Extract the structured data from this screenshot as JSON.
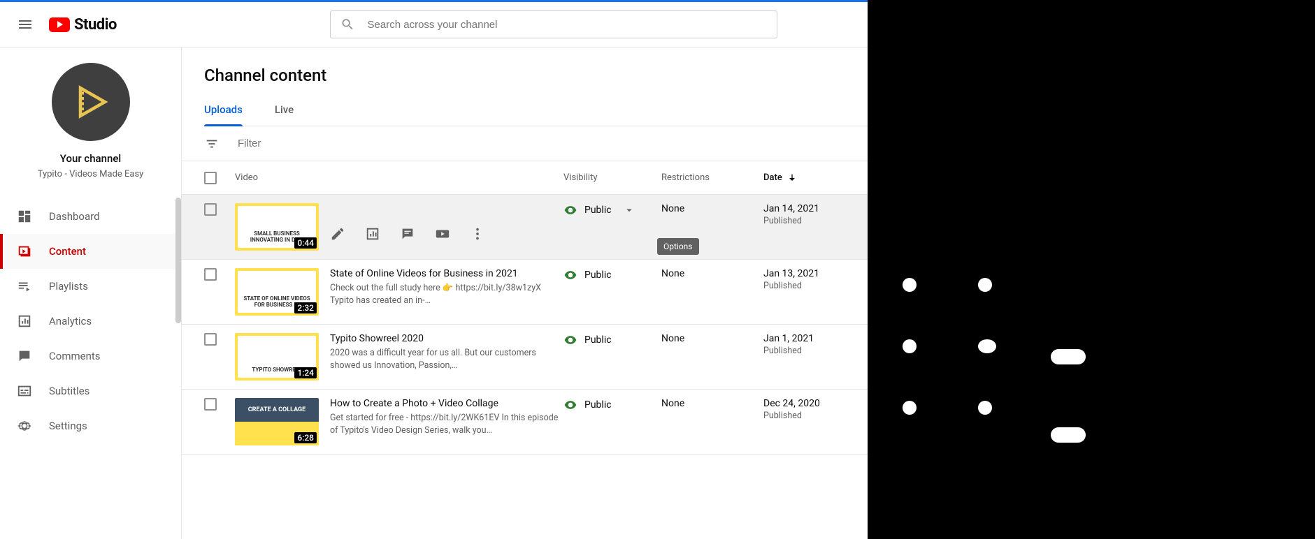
{
  "header": {
    "logo_text": "Studio",
    "search_placeholder": "Search across your channel"
  },
  "sidebar": {
    "channel_title": "Your channel",
    "channel_subtitle": "Typito - Videos Made Easy",
    "items": [
      {
        "label": "Dashboard",
        "icon": "dashboard"
      },
      {
        "label": "Content",
        "icon": "content",
        "active": true
      },
      {
        "label": "Playlists",
        "icon": "playlists"
      },
      {
        "label": "Analytics",
        "icon": "analytics"
      },
      {
        "label": "Comments",
        "icon": "comments"
      },
      {
        "label": "Subtitles",
        "icon": "subtitles"
      },
      {
        "label": "Settings",
        "icon": "settings"
      }
    ]
  },
  "page": {
    "title": "Channel content",
    "tabs": [
      {
        "label": "Uploads",
        "active": true
      },
      {
        "label": "Live"
      }
    ],
    "filter_placeholder": "Filter"
  },
  "columns": {
    "video": "Video",
    "visibility": "Visibility",
    "restrictions": "Restrictions",
    "date": "Date"
  },
  "hover_tooltip": "Options",
  "rows": [
    {
      "title": "",
      "description": "",
      "duration": "0:44",
      "visibility": "Public",
      "restrictions": "None",
      "date": "Jan 14, 2021",
      "date_sub": "Published",
      "hovered": true,
      "thumb_caption": "SMALL BUSINESS INNOVATING IN DIRE"
    },
    {
      "title": "State of Online Videos for Business in 2021",
      "description": "Check out the full study here 👉 https://bit.ly/38w1zyX Typito has created an in-…",
      "duration": "2:32",
      "visibility": "Public",
      "restrictions": "None",
      "date": "Jan 13, 2021",
      "date_sub": "Published",
      "thumb_caption": "STATE OF ONLINE VIDEOS FOR BUSINESS IN"
    },
    {
      "title": "Typito Showreel 2020",
      "description": "2020 was a difficult year for us all. But our customers showed us Innovation, Passion,…",
      "duration": "1:24",
      "visibility": "Public",
      "restrictions": "None",
      "date": "Jan 1, 2021",
      "date_sub": "Published",
      "thumb_caption": "TYPITO SHOWREEL"
    },
    {
      "title": "How to Create a Photo + Video Collage",
      "description": "Get started for free - https://bit.ly/2WK61EV In this episode of Typito's Video Design Series, walk you…",
      "duration": "6:28",
      "visibility": "Public",
      "restrictions": "None",
      "date": "Dec 24, 2020",
      "date_sub": "Published",
      "thumb_style": "collage",
      "thumb_caption": "CREATE A COLLAGE"
    }
  ]
}
